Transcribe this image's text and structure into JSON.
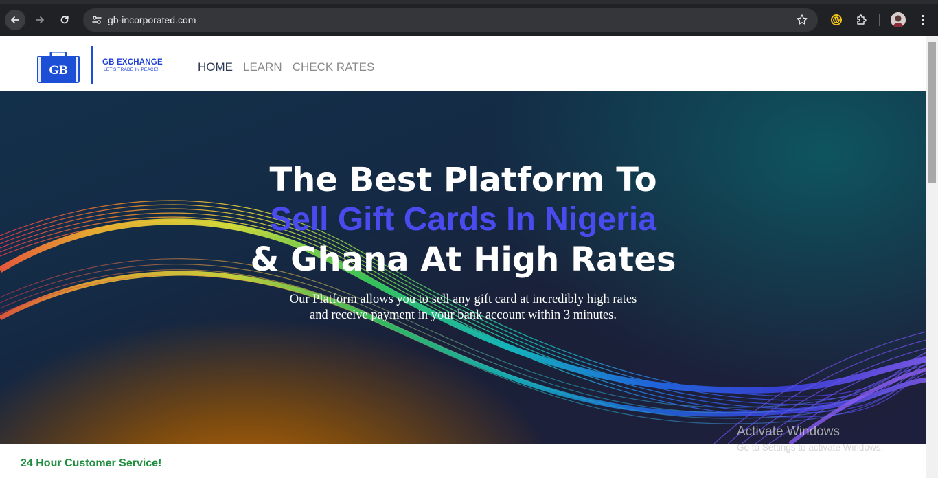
{
  "browser": {
    "url": "gb-incorporated.com"
  },
  "header": {
    "logo_mark": "GB",
    "logo_title": "GB EXCHANGE",
    "logo_tagline": "LET'S TRADE IN PEACE!",
    "nav": [
      {
        "label": "HOME",
        "active": true
      },
      {
        "label": "LEARN",
        "active": false
      },
      {
        "label": "CHECK RATES",
        "active": false
      }
    ]
  },
  "hero": {
    "line1": "The Best Platform To",
    "line2": "Sell Gift Cards In Nigeria",
    "line3": "& Ghana At High Rates",
    "sub1": "Our Platform allows you to sell any gift card at incredibly high rates",
    "sub2": "and receive payment in your bank account within 3 minutes."
  },
  "support": {
    "text": "24 Hour Customer Service!"
  },
  "overlay": {
    "title": "Activate Windows",
    "subtitle": "Go to Settings to activate Windows."
  },
  "colors": {
    "brand_blue": "#1d3fd6",
    "accent_headline": "#4a4bef",
    "support_green": "#1e8e3e",
    "browser_dark": "#202124"
  }
}
